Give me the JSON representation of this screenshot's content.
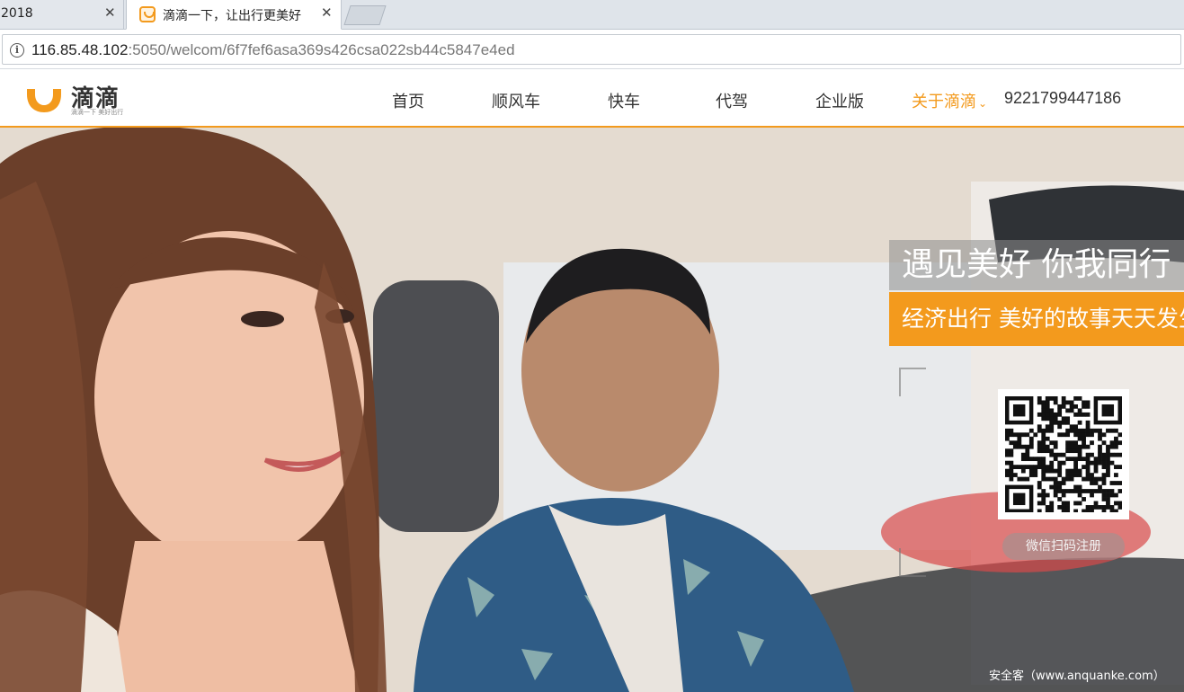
{
  "browser": {
    "tabs": [
      {
        "title": "2018"
      },
      {
        "title": "滴滴一下，让出行更美好"
      }
    ],
    "close_glyph": "✕",
    "url_host": "116.85.48.102",
    "url_rest": ":5050/welcom/6f7fef6asa369s426csa022sb44c5847e4ed",
    "info_glyph": "i"
  },
  "site": {
    "logo_text": "滴滴",
    "logo_tagline": "滴滴一下 美好出行",
    "brand_color": "#f39a1d",
    "nav": [
      {
        "label": "首页"
      },
      {
        "label": "顺风车"
      },
      {
        "label": "快车"
      },
      {
        "label": "代驾"
      },
      {
        "label": "企业版"
      },
      {
        "label": "关于滴滴",
        "active": true,
        "chevron": "⌄"
      }
    ],
    "phone": "9221799447186"
  },
  "hero": {
    "slogan_line1": "遇见美好 你我同行",
    "slogan_line2": "经济出行 美好的故事天天发生",
    "register_label": "微信扫码注册"
  },
  "watermark": "安全客（www.anquanke.com）"
}
